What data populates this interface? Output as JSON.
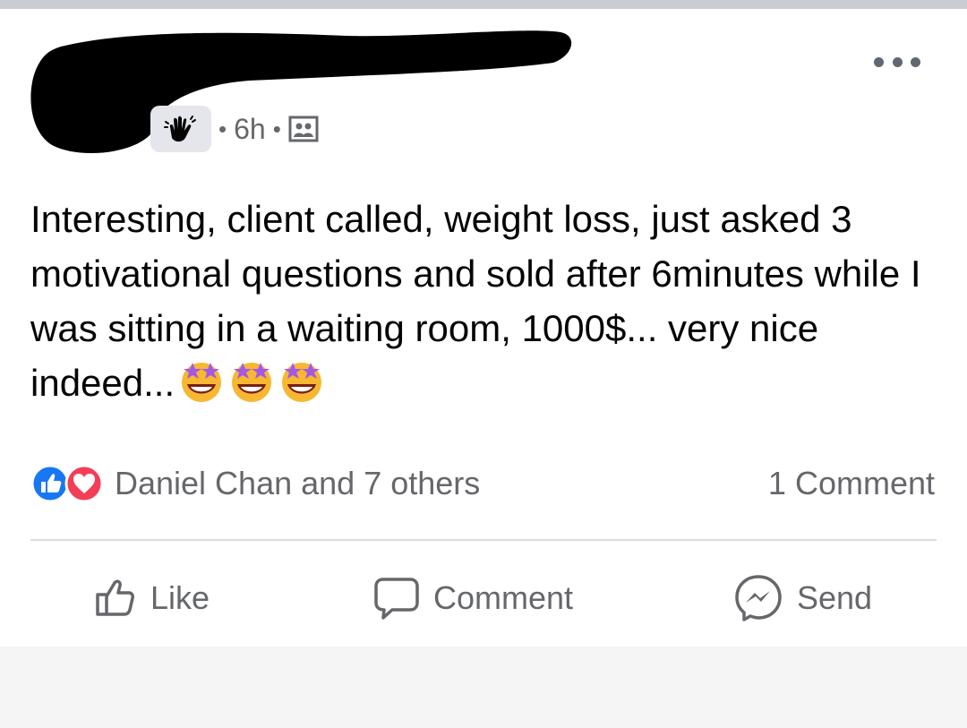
{
  "post": {
    "time": "6h",
    "separator": "•",
    "text": "Interesting, client called, weight loss, just asked 3 motivational questions and sold after 6minutes while I was sitting in a waiting room, 1000$... very nice indeed...",
    "emoji_names": [
      "star-struck-emoji",
      "star-struck-emoji",
      "star-struck-emoji"
    ]
  },
  "reactions": {
    "summary": "Daniel Chan and 7 others",
    "icons": [
      "like-reaction-icon",
      "love-reaction-icon"
    ],
    "comments": "1 Comment"
  },
  "actions": {
    "like": "Like",
    "comment": "Comment",
    "send": "Send"
  },
  "colors": {
    "like_blue": "#1877f2",
    "love_red": "#f33e58",
    "secondary_text": "#65676b",
    "divider": "#dadde1"
  }
}
